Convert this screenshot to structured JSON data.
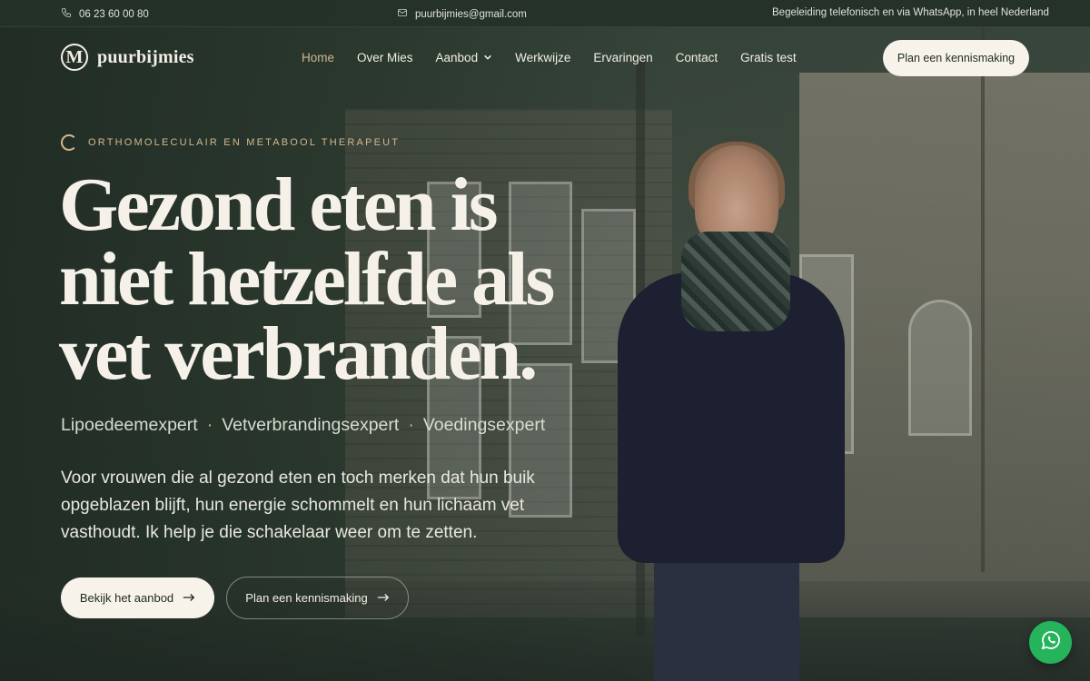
{
  "topbar": {
    "phone": "06 23 60 00 80",
    "email": "puurbijmies@gmail.com",
    "note": "Begeleiding telefonisch en via WhatsApp, in heel Nederland"
  },
  "brand": {
    "mark": "M",
    "name": "puurbijmies"
  },
  "nav": {
    "items": [
      {
        "label": "Home",
        "active": true
      },
      {
        "label": "Over Mies"
      },
      {
        "label": "Aanbod",
        "dropdown": true
      },
      {
        "label": "Werkwijze"
      },
      {
        "label": "Ervaringen"
      },
      {
        "label": "Contact"
      },
      {
        "label": "Gratis test"
      }
    ],
    "cta": "Plan een kennismaking"
  },
  "hero": {
    "eyebrow": "ORTHOMOLECULAIR EN METABOOL THERAPEUT",
    "headline_lines": [
      "Gezond eten is",
      "niet hetzelfde als",
      "vet verbranden."
    ],
    "specialties": [
      "Lipoedeemexpert",
      "Vetverbrandingsexpert",
      "Voedingsexpert"
    ],
    "separator": "·",
    "intro": "Voor vrouwen die al gezond eten en toch merken dat hun buik opgeblazen blijft, hun energie schommelt en hun lichaam vet vasthoudt. Ik help je die schakelaar weer om te zetten.",
    "primary_button": "Bekijk het aanbod",
    "secondary_button": "Plan een kennismaking"
  },
  "colors": {
    "accent": "#d2b88e",
    "cream": "#f7f3ea",
    "whatsapp": "#25b35c"
  },
  "icons": {
    "phone": "phone-icon",
    "email": "mail-icon",
    "dropdown": "chevron-down-icon",
    "arrow": "arrow-right-icon",
    "chat": "whatsapp-icon"
  }
}
